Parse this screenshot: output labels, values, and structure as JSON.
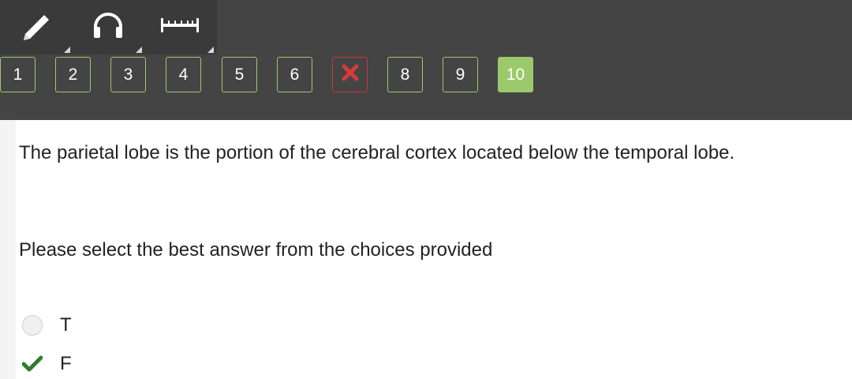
{
  "toolbar": {
    "tools": [
      {
        "icon": "pencil-icon"
      },
      {
        "icon": "headphones-icon"
      },
      {
        "icon": "ruler-icon"
      }
    ]
  },
  "question_nav": {
    "items": [
      {
        "label": "1",
        "status": "answered"
      },
      {
        "label": "2",
        "status": "answered"
      },
      {
        "label": "3",
        "status": "answered"
      },
      {
        "label": "4",
        "status": "answered"
      },
      {
        "label": "5",
        "status": "answered"
      },
      {
        "label": "6",
        "status": "answered"
      },
      {
        "label": "",
        "status": "incorrect",
        "icon": "x-icon"
      },
      {
        "label": "8",
        "status": "answered"
      },
      {
        "label": "9",
        "status": "answered"
      },
      {
        "label": "10",
        "status": "current"
      }
    ]
  },
  "question": {
    "text": "The parietal lobe is the portion of the cerebral cortex located below the temporal lobe.",
    "instructions": "Please select the best answer from the choices provided"
  },
  "choices": [
    {
      "label": "T",
      "selected": false
    },
    {
      "label": "F",
      "selected": true
    }
  ],
  "colors": {
    "header_bg": "#444444",
    "accent_green": "#9cc96b",
    "wrong_red": "#c93a3a",
    "check_green": "#2e7d32"
  }
}
